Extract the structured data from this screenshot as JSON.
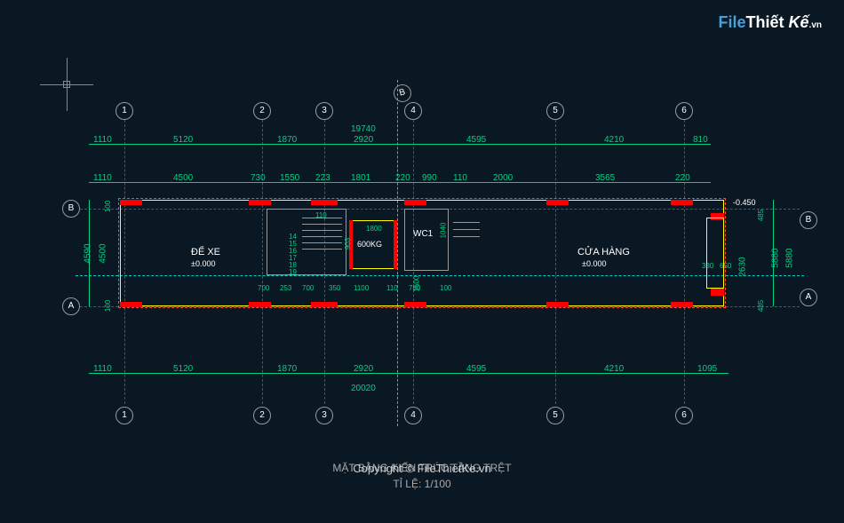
{
  "watermark": {
    "file": "File",
    "thiet": "Thiết",
    "ke": "Kế",
    "vn": ".vn"
  },
  "title": {
    "main": "MẶT BẰNG KIẾN TRÚC TẦNG TRỆT",
    "scale": "TỈ LỆ: 1/100",
    "copyright": "Copyright © FileThietKe.vn"
  },
  "grids": {
    "vertical": [
      "1",
      "2",
      "3",
      "4",
      "5",
      "6"
    ],
    "horizontal": [
      "A",
      "B"
    ],
    "diagonal": "B"
  },
  "rooms": {
    "parking": {
      "name": "ĐỂ XE",
      "elev": "±0.000"
    },
    "elevator": {
      "name": "600KG"
    },
    "wc": {
      "name": "WC1"
    },
    "shop": {
      "name": "CỬA HÀNG",
      "elev": "±0.000"
    }
  },
  "dimensions": {
    "top_outer": [
      "1110",
      "5120",
      "1870",
      "2920",
      "4595",
      "4210",
      "810"
    ],
    "top_total": "19740",
    "top_inner": [
      "1110",
      "4500",
      "730",
      "1550",
      "223",
      "1801",
      "220",
      "990",
      "110",
      "2000",
      "3565",
      "220"
    ],
    "bottom_outer": [
      "1110",
      "5120",
      "1870",
      "2920",
      "4595",
      "4210",
      "1095"
    ],
    "bottom_total": "20020",
    "bottom_inner": [
      "700",
      "253",
      "700",
      "350",
      "1100",
      "110",
      "780",
      "100"
    ],
    "left": [
      "4590",
      "4500"
    ],
    "left_small": [
      "100",
      "100"
    ],
    "right": [
      "5880",
      "5880",
      "2630"
    ],
    "right_small": [
      "485",
      "485",
      "330",
      "650"
    ],
    "elev_right": "-0.450",
    "stair_dims": [
      "1800",
      "1040",
      "1500"
    ],
    "stair_nums": [
      "14",
      "15",
      "16",
      "17",
      "18",
      "19"
    ],
    "inner_small": [
      "110",
      "903"
    ]
  }
}
